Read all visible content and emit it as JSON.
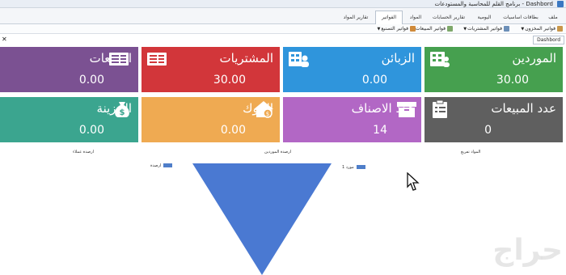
{
  "window": {
    "title": "Dashbord - برنامج القلم للمحاسبة والمستودعات"
  },
  "tabs": [
    {
      "label": "ملف",
      "active": false
    },
    {
      "label": "بطاقات اساسيات",
      "active": false
    },
    {
      "label": "اليومية",
      "active": false
    },
    {
      "label": "تقارير الحسابات",
      "active": false
    },
    {
      "label": "المواد",
      "active": false
    },
    {
      "label": "الفواتير",
      "active": true
    },
    {
      "label": "تقارير المواد",
      "active": false
    }
  ],
  "ribbon": [
    {
      "label": "فواتير المخزون",
      "icon": "warehouse-invoice-icon"
    },
    {
      "label": "فواتير المشتريات",
      "icon": "purchase-invoice-icon"
    },
    {
      "label": "فواتير المبيعات",
      "icon": "sales-invoice-icon"
    },
    {
      "label": "فواتير التصنيع",
      "icon": "manufacturing-invoice-icon"
    }
  ],
  "document_tab": "Dashbord",
  "tiles": [
    {
      "title": "الموردين",
      "value": "30.00",
      "color": "#46a04f",
      "icon": "suppliers-icon"
    },
    {
      "title": "الزبائن",
      "value": "0.00",
      "color": "#2f95dc",
      "icon": "customers-icon"
    },
    {
      "title": "المشتريات",
      "value": "30.00",
      "color": "#d2363a",
      "icon": "purchases-icon"
    },
    {
      "title": "المبيعات",
      "value": "0.00",
      "color": "#7b5192",
      "icon": "sales-icon"
    },
    {
      "title": "عدد المبيعات",
      "value": "0",
      "color": "#5f5f5f",
      "icon": "clipboard-icon"
    },
    {
      "title": "عدد الاصناف",
      "value": "14",
      "color": "#b267c5",
      "icon": "box-icon"
    },
    {
      "title": "البنوك",
      "value": "0.00",
      "color": "#efaa52",
      "icon": "bank-icon"
    },
    {
      "title": "الخزينة",
      "value": "0.00",
      "color": "#3ba58f",
      "icon": "money-bag-icon"
    }
  ],
  "panels": {
    "left_title": "ارصدة عملاء",
    "middle_title": "ارصدة الموردين",
    "right_title": "المواد تفريغ"
  },
  "legends": {
    "middle": "ارصدة",
    "right": "مورد 1"
  },
  "watermark": "حراج",
  "colors": {
    "funnel": "#4a79d2",
    "legend_swatch": "#4f7ec9"
  }
}
